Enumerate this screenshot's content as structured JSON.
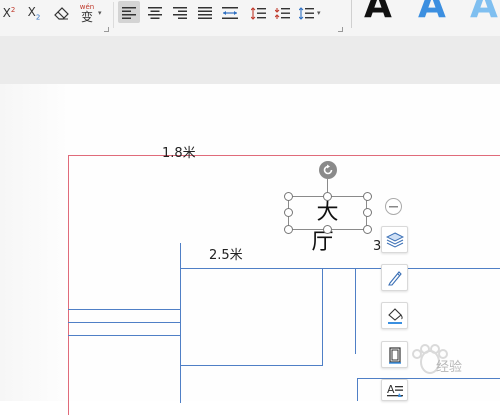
{
  "toolbar": {
    "superscript": {
      "base": "X",
      "exp": "2"
    },
    "subscript": {
      "base": "X",
      "sub": "2"
    },
    "phonetic": {
      "top": "wén",
      "char": "变"
    },
    "wordart": [
      "A",
      "A",
      "A"
    ],
    "colors": {
      "wordart_black": "#111111",
      "wordart_blue": "#3c8fe0",
      "wordart_light": "#7fbff0"
    }
  },
  "page": {
    "textbox_text": "大 厅",
    "labels": {
      "top_dim": "1.8米",
      "mid_dim": "2.5米",
      "right_dim_partial": "3"
    }
  },
  "watermark": {
    "text": "经验"
  },
  "colors": {
    "plan_border": "#e06b7a",
    "plan_lines": "#4f7fc6",
    "selected_bg": "#d4d4d4"
  }
}
